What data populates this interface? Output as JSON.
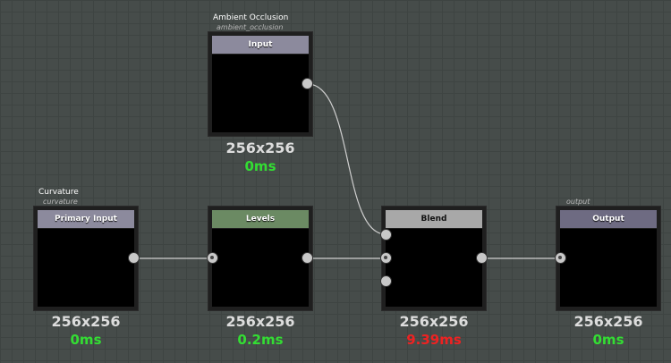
{
  "colors": {
    "background": "#464c4a",
    "wire": "#cfcfcf",
    "time_ok": "#33dd33",
    "time_slow": "#ee2222",
    "header_input": "#8c8a9d",
    "header_levels": "#6b8a63",
    "header_blend": "#a8a8a8",
    "header_output": "#6e6b82"
  },
  "nodes": {
    "ambient_input": {
      "label": "Ambient Occlusion",
      "sub": "ambient_occlusion",
      "header": "Input",
      "resolution": "256x256",
      "time": "0ms"
    },
    "curvature_input": {
      "label": "Curvature",
      "sub": "curvature",
      "header": "Primary Input",
      "resolution": "256x256",
      "time": "0ms"
    },
    "levels": {
      "header": "Levels",
      "resolution": "256x256",
      "time": "0.2ms"
    },
    "blend": {
      "header": "Blend",
      "resolution": "256x256",
      "time": "9.39ms"
    },
    "output": {
      "sub": "output",
      "header": "Output",
      "resolution": "256x256",
      "time": "0ms"
    }
  }
}
